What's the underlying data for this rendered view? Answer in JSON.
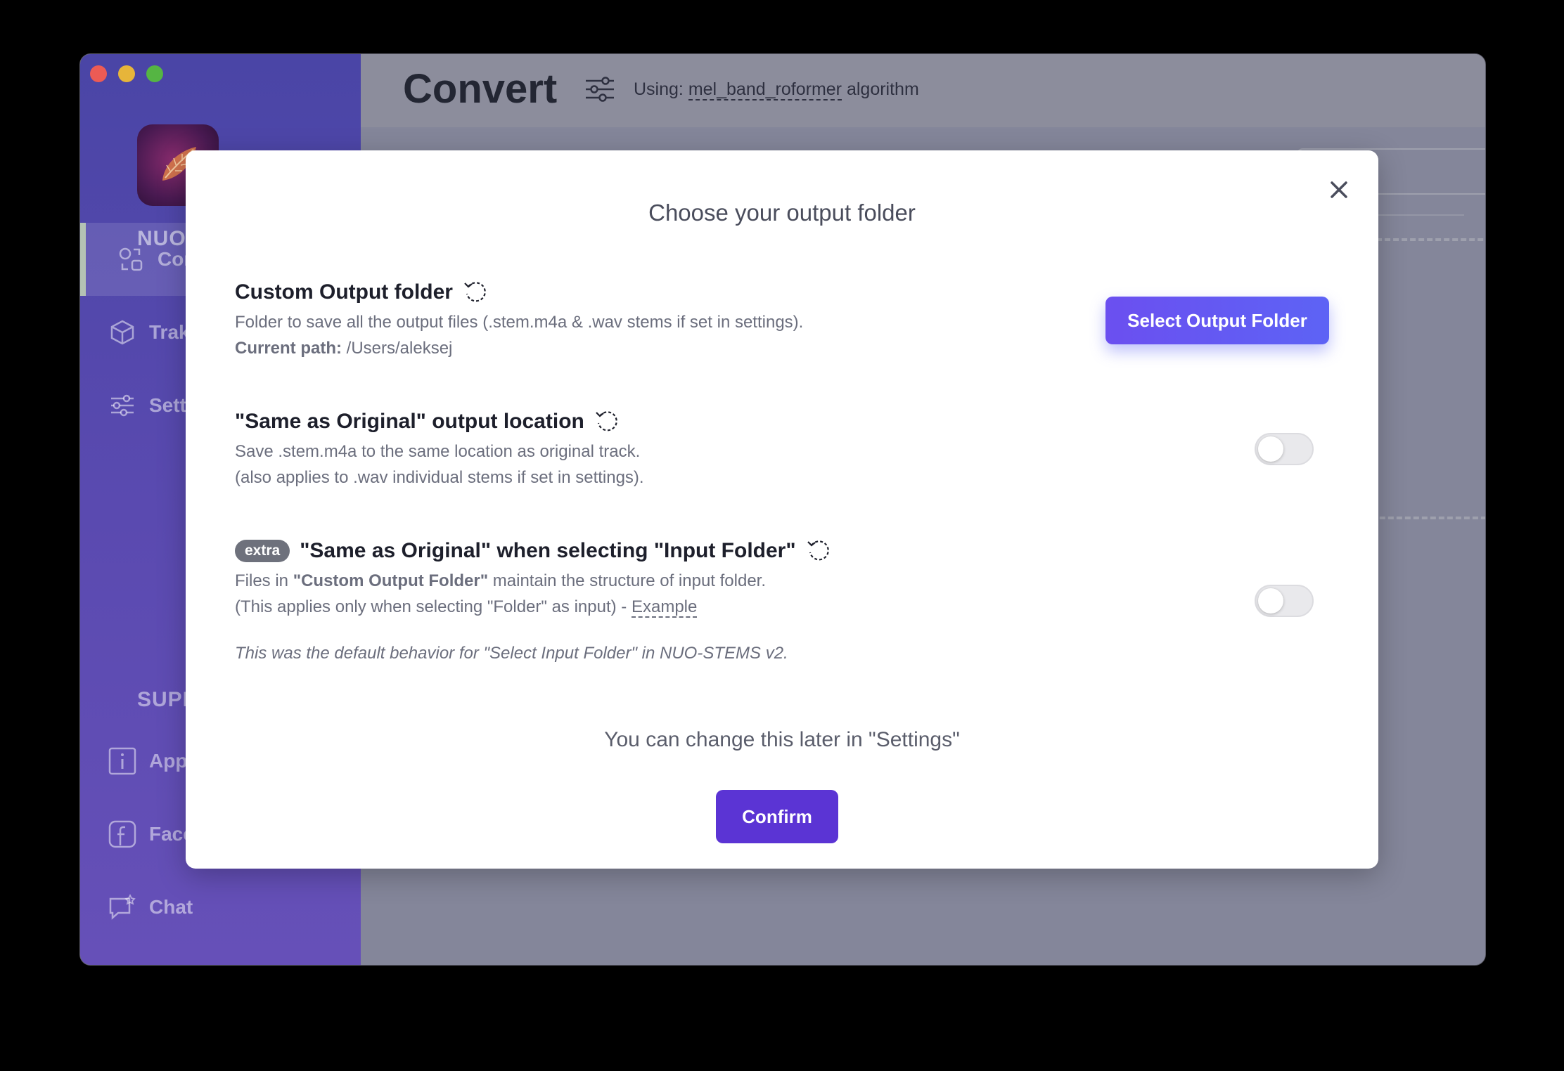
{
  "app": {
    "name": "NUO",
    "nav": [
      {
        "label": "Con",
        "icon": "convert-icon"
      },
      {
        "label": "Trak",
        "icon": "box-icon"
      },
      {
        "label": "Setti",
        "icon": "sliders-icon"
      }
    ],
    "support_title": "SUPP",
    "support": [
      {
        "label": "App",
        "icon": "info-icon"
      },
      {
        "label": "Face",
        "icon": "facebook-icon"
      },
      {
        "label": "Chat",
        "icon": "chat-icon"
      }
    ]
  },
  "header": {
    "title": "Convert",
    "algo_prefix": "Using:",
    "algo_name": "mel_band_roformer",
    "algo_suffix": "algorithm"
  },
  "modal": {
    "title": "Choose your output folder",
    "custom": {
      "title": "Custom Output folder",
      "desc": "Folder to save all the output files (.stem.m4a & .wav stems if set in settings).",
      "path_label": "Current path:",
      "path_value": "/Users/aleksej",
      "button": "Select Output Folder"
    },
    "same": {
      "title": "\"Same as Original\" output location",
      "desc1": "Save .stem.m4a to the same location as original track.",
      "desc2": "(also applies to .wav individual stems if set in settings).",
      "enabled": false
    },
    "extra": {
      "badge": "extra",
      "title": "\"Same as Original\" when selecting \"Input Folder\"",
      "desc_pre": "Files in",
      "desc_bold": "\"Custom Output Folder\"",
      "desc_post": "maintain the structure of input folder.",
      "desc2": "(This applies only when selecting \"Folder\" as input) -",
      "example": "Example",
      "enabled": false
    },
    "note": "This was the default behavior for \"Select Input Folder\" in NUO-STEMS v2.",
    "later": "You can change this later in \"Settings\"",
    "confirm": "Confirm"
  }
}
